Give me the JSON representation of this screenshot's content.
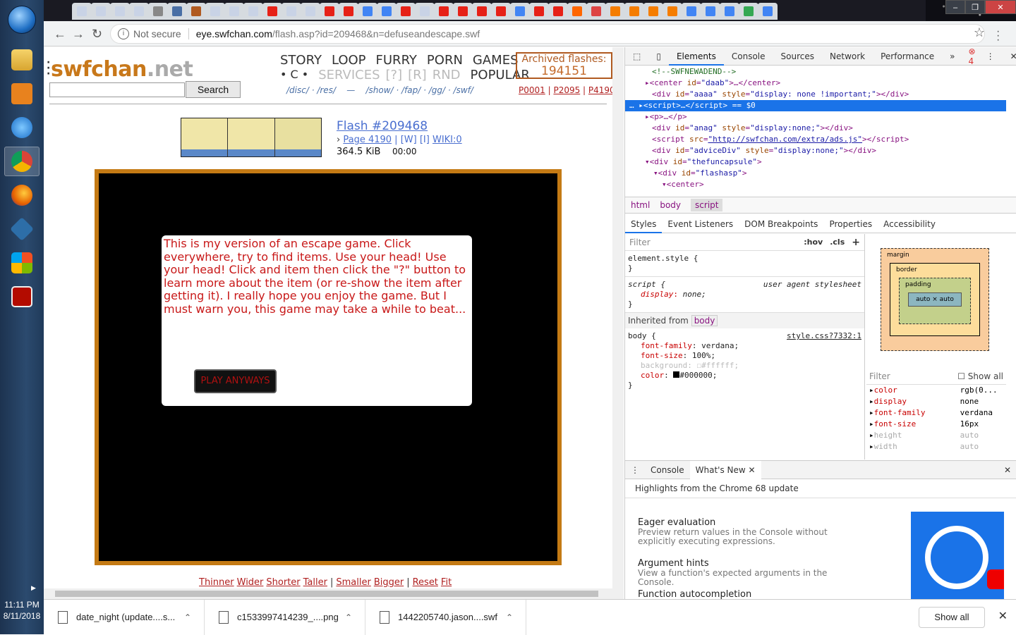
{
  "taskbar": {
    "clock_time": "11:11 PM",
    "clock_date": "8/11/2018",
    "apps": [
      "file-explorer",
      "media-player",
      "internet-explorer",
      "chrome",
      "firefox",
      "virtualbox",
      "windows-update",
      "acrobat"
    ]
  },
  "browser": {
    "security_label": "Not secure",
    "url_domain": "eye.swfchan.com",
    "url_path": "/flash.asp?id=209468&n=defuseandescape.swf"
  },
  "site": {
    "logo_main": "swfchan",
    "logo_tld": ".net",
    "search_button": "Search",
    "nav_row1": [
      "STORY",
      "LOOP",
      "FURRY",
      "PORN",
      "GAMES"
    ],
    "nav_row2_prefix": "• C •",
    "nav_row2_dim": [
      "SERVICES",
      "[?]",
      "[R]",
      "RND"
    ],
    "nav_row2_last": "POPULAR",
    "sublinks": "/disc/ · /res/    —    /show/ · /fap/ · /gg/ · /swf/",
    "archived_label": "Archived flashes:",
    "archived_count": "194151",
    "page_links": [
      "P0001",
      "P2095",
      "P4190"
    ]
  },
  "flash": {
    "title": "Flash #209468",
    "page_link": "Page 4190",
    "w_link": "[W]",
    "i_link": "[I]",
    "wiki_link": "WIKI:0",
    "size": "364.5 KiB",
    "duration": "00:00",
    "dialog_text": "This is my version of an escape game. Click everywhere, try to find items. Use your head! Use your head! Click and item then click the \"?\" button to learn more about the item (or re-show the item after getting it). I really hope you enjoy the game. But I must warn you, this game may take a while to beat...",
    "play_button": "PLAY ANYWAYS"
  },
  "sizer": {
    "thinner": "Thinner",
    "wider": "Wider",
    "shorter": "Shorter",
    "taller": "Taller",
    "smaller": "Smaller",
    "bigger": "Bigger",
    "reset": "Reset",
    "fit": "Fit"
  },
  "devtools": {
    "tabs": [
      "Elements",
      "Console",
      "Sources",
      "Network",
      "Performance"
    ],
    "more": "»",
    "error_count": "4",
    "crumbs": [
      "html",
      "body",
      "script"
    ],
    "subtabs": [
      "Styles",
      "Event Listeners",
      "DOM Breakpoints",
      "Properties",
      "Accessibility"
    ],
    "filter_placeholder": "Filter",
    "hov": ":hov",
    "cls": ".cls",
    "element_style": "element.style {",
    "ua_label": "user agent stylesheet",
    "inherited_from": "Inherited from",
    "style_source": "style.css?7332:1",
    "show_all": "Show all",
    "computed": [
      {
        "k": "color",
        "v": "rgb(0..."
      },
      {
        "k": "display",
        "v": "none"
      },
      {
        "k": "font-family",
        "v": "verdana"
      },
      {
        "k": "font-size",
        "v": "16px"
      },
      {
        "k": "height",
        "v": "auto"
      },
      {
        "k": "width",
        "v": "auto"
      }
    ],
    "box_labels": {
      "margin": "margin",
      "border": "border",
      "padding": "padding",
      "content": "auto × auto",
      "dash": "–"
    },
    "drawer_tabs": [
      "Console",
      "What's New"
    ],
    "highlights": "Highlights from the Chrome 68 update",
    "features": [
      {
        "title": "Eager evaluation",
        "desc": "Preview return values in the Console without explicitly executing expressions."
      },
      {
        "title": "Argument hints",
        "desc": "View a function's expected arguments in the Console."
      },
      {
        "title": "Function autocompletion",
        "desc": ""
      }
    ]
  },
  "downloads": {
    "items": [
      "date_night (update....s...",
      "c1533997414239_....png",
      "1442205740.jason....swf"
    ],
    "show_all": "Show all"
  }
}
